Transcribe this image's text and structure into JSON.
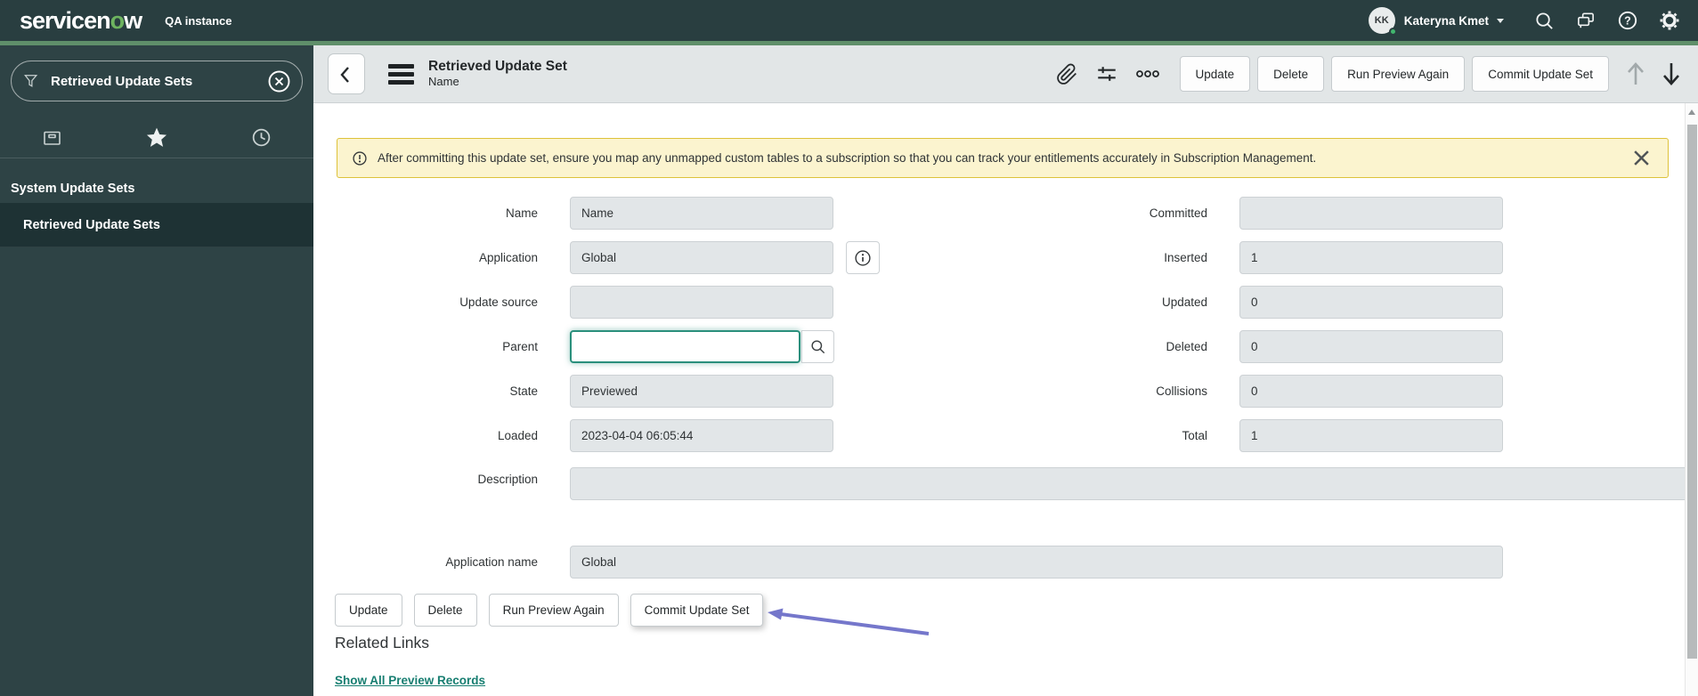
{
  "colors": {
    "brand_green": "#6db35f",
    "header_bg": "#293e40",
    "sidebar_bg": "#2e4345",
    "sidebar_selected_bg": "#1e3234",
    "accent_line_green": "#5f8f6a",
    "form_header_bg": "#e2e6e7",
    "banner_bg": "#fbf4cf",
    "banner_border": "#ddc23a",
    "focus_teal": "#2a8f7c",
    "link_teal": "#177e71",
    "annotation_arrow_purple": "#7577cb"
  },
  "top_header": {
    "logo": {
      "pre": "servicen",
      "accent": "o",
      "post": "w"
    },
    "instance_label": "QA instance",
    "user": {
      "initials": "KK",
      "name": "Kateryna Kmet"
    }
  },
  "sidebar": {
    "filter_value": "Retrieved Update Sets",
    "section_label": "System Update Sets",
    "selected_item": "Retrieved Update Sets"
  },
  "form_header": {
    "title": "Retrieved Update Set",
    "subtitle": "Name",
    "buttons": {
      "update": "Update",
      "delete": "Delete",
      "run_preview": "Run Preview Again",
      "commit": "Commit Update Set"
    }
  },
  "banner": {
    "text": "After committing this update set, ensure you map any unmapped custom tables to a subscription so that you can track your entitlements accurately in Subscription Management."
  },
  "form": {
    "name": {
      "label": "Name",
      "value": "Name"
    },
    "application": {
      "label": "Application",
      "value": "Global"
    },
    "update_source": {
      "label": "Update source",
      "value": ""
    },
    "parent": {
      "label": "Parent",
      "value": ""
    },
    "state": {
      "label": "State",
      "value": "Previewed"
    },
    "loaded": {
      "label": "Loaded",
      "value": "2023-04-04 06:05:44"
    },
    "description": {
      "label": "Description",
      "value": ""
    },
    "application_name": {
      "label": "Application name",
      "value": "Global"
    },
    "committed": {
      "label": "Committed",
      "value": ""
    },
    "inserted": {
      "label": "Inserted",
      "value": "1"
    },
    "updated": {
      "label": "Updated",
      "value": "0"
    },
    "deleted": {
      "label": "Deleted",
      "value": "0"
    },
    "collisions": {
      "label": "Collisions",
      "value": "0"
    },
    "total": {
      "label": "Total",
      "value": "1"
    }
  },
  "footer": {
    "buttons": {
      "update": "Update",
      "delete": "Delete",
      "run_preview": "Run Preview Again",
      "commit": "Commit Update Set"
    },
    "related_links_heading": "Related Links",
    "link_show_all": "Show All Preview Records"
  }
}
